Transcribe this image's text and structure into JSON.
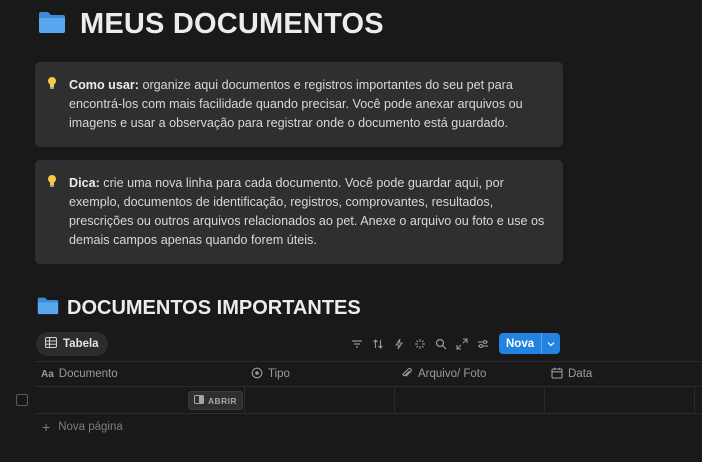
{
  "header": {
    "title": "MEUS DOCUMENTOS",
    "icon": "folder-icon"
  },
  "callouts": [
    {
      "icon": "lightbulb-icon",
      "label": "Como usar:",
      "text": " organize aqui documentos e registros importantes do seu pet para encontrá-los com mais facilidade quando precisar. Você pode anexar arquivos ou imagens e usar a observação para registrar onde o documento está guardado."
    },
    {
      "icon": "lightbulb-icon",
      "label": "Dica:",
      "text": " crie uma nova linha para cada documento. Você pode guardar aqui, por exemplo, documentos de identificação, registros, comprovantes, resultados, prescrições ou outros arquivos relacionados ao pet. Anexe o arquivo ou foto e use os demais campos apenas quando forem úteis."
    }
  ],
  "database": {
    "title": "DOCUMENTOS IMPORTANTES",
    "view_tab": "Tabela",
    "new_button": "Nova",
    "columns": [
      {
        "label": "Documento",
        "icon": "text-icon"
      },
      {
        "label": "Tipo",
        "icon": "status-icon"
      },
      {
        "label": "Arquivo/ Foto",
        "icon": "paperclip-icon"
      },
      {
        "label": "Data",
        "icon": "calendar-icon"
      }
    ],
    "open_label": "ABRIR",
    "new_page_label": "Nova página"
  },
  "colors": {
    "background": "#191919",
    "callout": "#2f2f2f",
    "accent": "#2383e2"
  }
}
